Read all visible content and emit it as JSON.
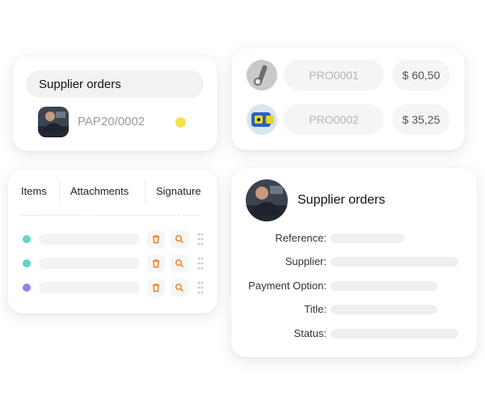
{
  "orders_card": {
    "title": "Supplier orders",
    "order_code": "PAP20/0002",
    "status_color": "#f7e04a",
    "thumbnail": "mechanic-photo"
  },
  "products_card": {
    "rows": [
      {
        "code": "PRO0001",
        "price": "$ 60,50",
        "thumbnail": "wrench-photo"
      },
      {
        "code": "PRO0002",
        "price": "$ 35,25",
        "thumbnail": "measuring-tool-photo"
      }
    ]
  },
  "items_card": {
    "tabs": [
      "Items",
      "Attachments",
      "Signature"
    ],
    "rows": [
      {
        "dot_color": "#5ed6c8"
      },
      {
        "dot_color": "#5ed6c8"
      },
      {
        "dot_color": "#9b7bf0"
      }
    ],
    "action_color": "#f07c1c"
  },
  "detail_card": {
    "title": "Supplier orders",
    "avatar": "mechanic-photo",
    "fields": [
      {
        "label": "Reference:"
      },
      {
        "label": "Supplier:"
      },
      {
        "label": "Payment Option:"
      },
      {
        "label": "Title:"
      },
      {
        "label": "Status:"
      }
    ]
  }
}
